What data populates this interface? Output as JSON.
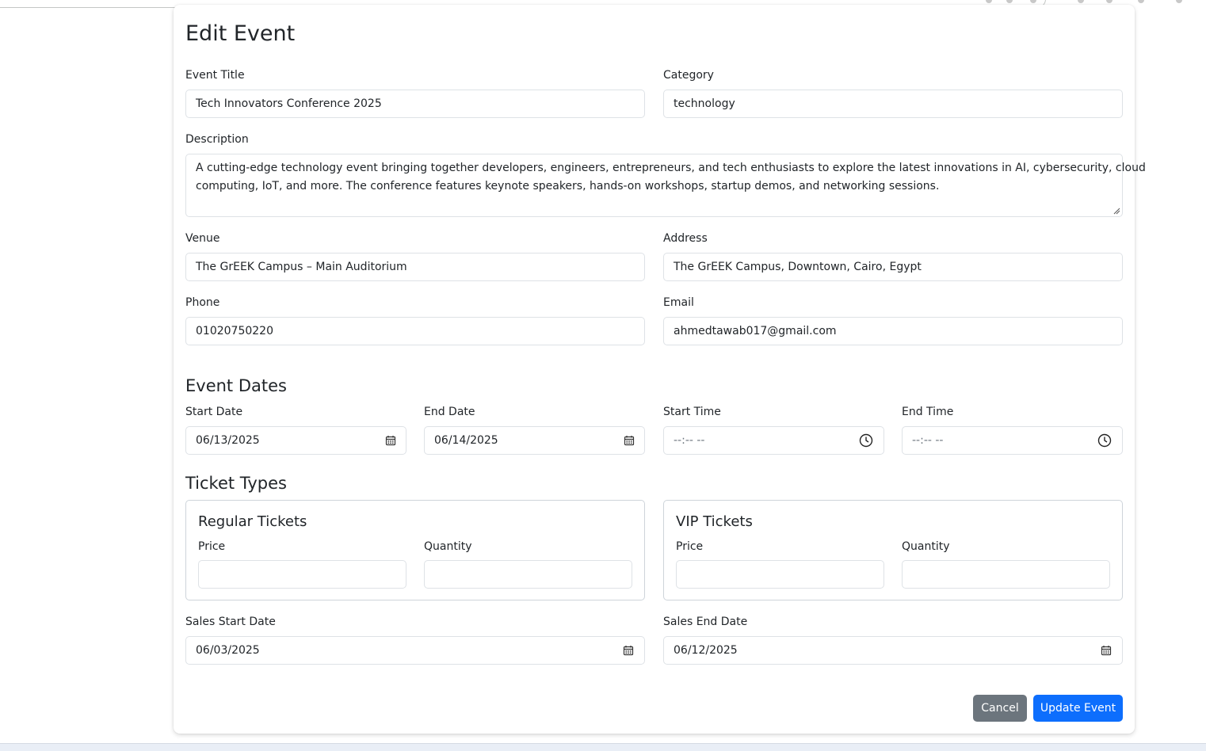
{
  "form": {
    "title": "Edit Event",
    "event_title": {
      "label": "Event Title",
      "value": "Tech Innovators Conference 2025"
    },
    "category": {
      "label": "Category",
      "value": "technology"
    },
    "description": {
      "label": "Description",
      "line1": "A cutting-edge technology event bringing together developers, engineers, entrepreneurs, and tech enthusiasts to explore the latest innovations in AI, cybersecurity, cloud",
      "line2": "computing, IoT, and more. The conference features keynote speakers, hands-on workshops, startup demos, and networking sessions."
    },
    "venue": {
      "label": "Venue",
      "value": "The GrEEK Campus – Main Auditorium"
    },
    "address": {
      "label": "Address",
      "value": "The GrEEK Campus, Downtown, Cairo, Egypt"
    },
    "phone": {
      "label": "Phone",
      "value": "01020750220"
    },
    "email": {
      "label": "Email",
      "value": "ahmedtawab017@gmail.com"
    }
  },
  "dates": {
    "heading": "Event Dates",
    "start_date": {
      "label": "Start Date",
      "value": "06/13/2025",
      "icon": "calendar-icon"
    },
    "end_date": {
      "label": "End Date",
      "value": "06/14/2025",
      "icon": "calendar-icon"
    },
    "start_time": {
      "label": "Start Time",
      "value": "--:-- --",
      "icon": "clock-icon"
    },
    "end_time": {
      "label": "End Time",
      "value": "--:-- --",
      "icon": "clock-icon"
    }
  },
  "tickets": {
    "heading": "Ticket Types",
    "regular": {
      "title": "Regular Tickets",
      "price_label": "Price",
      "price_value": "",
      "quantity_label": "Quantity",
      "quantity_value": ""
    },
    "vip": {
      "title": "VIP Tickets",
      "price_label": "Price",
      "price_value": "",
      "quantity_label": "Quantity",
      "quantity_value": ""
    },
    "sales_start": {
      "label": "Sales Start Date",
      "value": "06/03/2025"
    },
    "sales_end": {
      "label": "Sales End Date",
      "value": "06/12/2025"
    }
  },
  "actions": {
    "cancel_label": "Cancel",
    "update_label": "Update Event"
  },
  "colors": {
    "primary": "#0d6efd",
    "secondary": "#6c757d",
    "border": "#dee2e6"
  }
}
